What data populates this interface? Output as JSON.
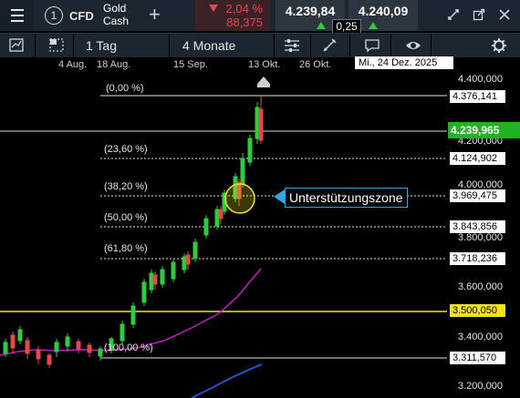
{
  "header": {
    "instrument_number": "1",
    "type": "CFD",
    "asset_line1": "Gold",
    "asset_line2": "Cash",
    "change_pct": "2,04 %",
    "change_abs": "88,375",
    "bid": "4.239,84",
    "ask": "4.240,09",
    "spread": "0,25",
    "colors": {
      "negative": "#e04a4a",
      "positive": "#2ecc40",
      "background": "#1c2630"
    }
  },
  "toolbar": {
    "interval": "1 Tag",
    "range": "4 Monate"
  },
  "date_axis": {
    "labels": [
      "4 Aug.",
      "18 Aug.",
      "15 Sep.",
      "13 Okt.",
      "26 Okt."
    ],
    "cursor_date": "Mi., 24 Dez. 2025"
  },
  "fibonacci": [
    {
      "label": "(0,00 %)",
      "price": "4.376,141"
    },
    {
      "label": "(23,60 %)",
      "price": "4.124,902"
    },
    {
      "label": "(38,20 %)",
      "price": "3.969,475"
    },
    {
      "label": "(50,00 %)",
      "price": "3.843,856"
    },
    {
      "label": "(61,80 %)",
      "price": "3.718,236"
    },
    {
      "label": "(100,00 %)",
      "price": "3.311,570"
    }
  ],
  "price_axis": {
    "ticks": [
      "4.400,000",
      "4.200,000",
      "4.000,000",
      "3.800,000",
      "3.600,000",
      "3.400,000",
      "3.200,000"
    ],
    "current_price": "4.239,965",
    "horizontal_line_price": "3.500,050"
  },
  "annotation": {
    "text": "Unterstützungszone"
  },
  "chart_data": {
    "type": "candlestick",
    "x_range": [
      "4 Aug.",
      "24 Dez. 2025"
    ],
    "y_range": [
      3200,
      4400
    ],
    "moving_averages": [
      "magenta",
      "blue"
    ]
  }
}
